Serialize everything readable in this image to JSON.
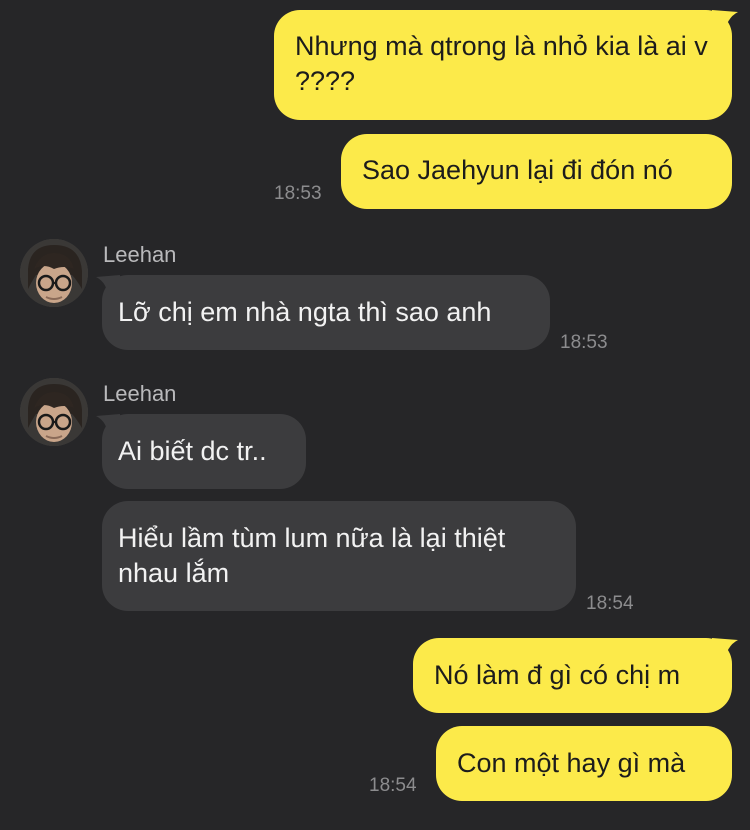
{
  "colors": {
    "background": "#262628",
    "outgoing_bubble": "#fcea4a",
    "incoming_bubble": "#3c3c3e",
    "timestamp": "#8c8c8e",
    "sender_name": "#b9b9bb"
  },
  "messages": [
    {
      "direction": "out",
      "text": "Nhưng mà qtrong là nhỏ kia là ai v ????"
    },
    {
      "direction": "out",
      "text": "Sao Jaehyun lại đi đón nó",
      "time": "18:53"
    },
    {
      "direction": "in",
      "sender": "Leehan",
      "avatar_icon": "profile-photo-icon",
      "text": "Lỡ chị em nhà ngta thì sao anh",
      "time": "18:53"
    },
    {
      "direction": "in",
      "sender": "Leehan",
      "avatar_icon": "profile-photo-icon",
      "text": "Ai biết dc tr.."
    },
    {
      "direction": "in",
      "text": "Hiểu lầm tùm lum nữa là lại thiệt nhau lắm",
      "time": "18:54"
    },
    {
      "direction": "out",
      "text": "Nó làm đ gì có chị m"
    },
    {
      "direction": "out",
      "text": "Con một hay gì mà",
      "time": "18:54"
    }
  ]
}
